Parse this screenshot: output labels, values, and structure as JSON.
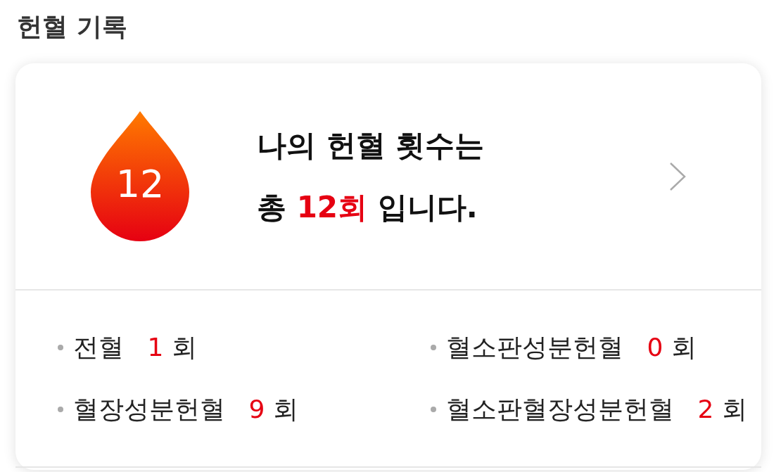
{
  "header": {
    "title": "헌혈 기록"
  },
  "summary": {
    "count_badge": "12",
    "line_1": "나의 헌혈 횟수는",
    "line_2_prefix": "총",
    "line_2_highlight": "12회",
    "line_2_suffix": "입니다."
  },
  "stats": [
    {
      "label": "전혈",
      "value": "1",
      "unit": "회"
    },
    {
      "label": "혈소판성분헌혈",
      "value": "0",
      "unit": "회"
    },
    {
      "label": "혈장성분헌혈",
      "value": "9",
      "unit": "회"
    },
    {
      "label": "혈소판혈장성분헌혈",
      "value": "2",
      "unit": "회"
    }
  ]
}
